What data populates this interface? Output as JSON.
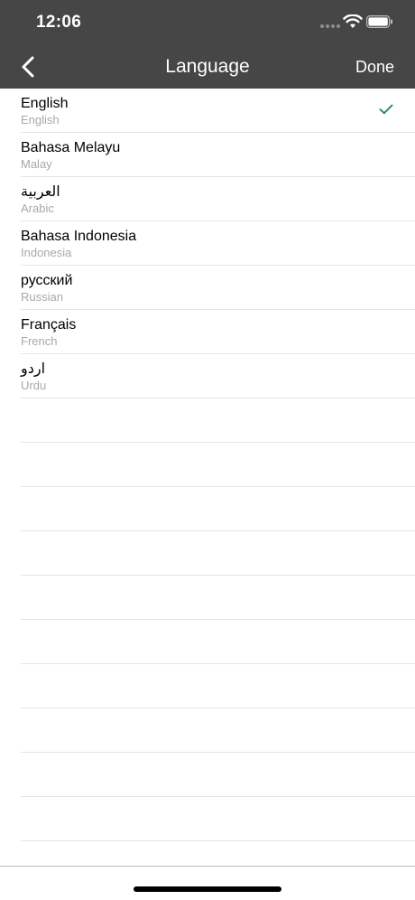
{
  "status_bar": {
    "time": "12:06"
  },
  "nav": {
    "title": "Language",
    "done_label": "Done"
  },
  "languages": [
    {
      "name": "English",
      "subtitle": "English",
      "selected": true
    },
    {
      "name": "Bahasa Melayu",
      "subtitle": "Malay",
      "selected": false
    },
    {
      "name": "العربية",
      "subtitle": "Arabic",
      "selected": false
    },
    {
      "name": "Bahasa Indonesia",
      "subtitle": "Indonesia",
      "selected": false
    },
    {
      "name": "русский",
      "subtitle": "Russian",
      "selected": false
    },
    {
      "name": "Français",
      "subtitle": "French",
      "selected": false
    },
    {
      "name": "اردو",
      "subtitle": "Urdu",
      "selected": false
    }
  ],
  "colors": {
    "nav_background": "#464646",
    "check_accent": "#2e8b57",
    "subtitle_text": "#a8a8a8",
    "separator": "#e4e4e4"
  },
  "icons": {
    "back": "chevron-left-icon",
    "selected": "checkmark-icon",
    "wifi": "wifi-icon",
    "battery": "battery-icon"
  }
}
